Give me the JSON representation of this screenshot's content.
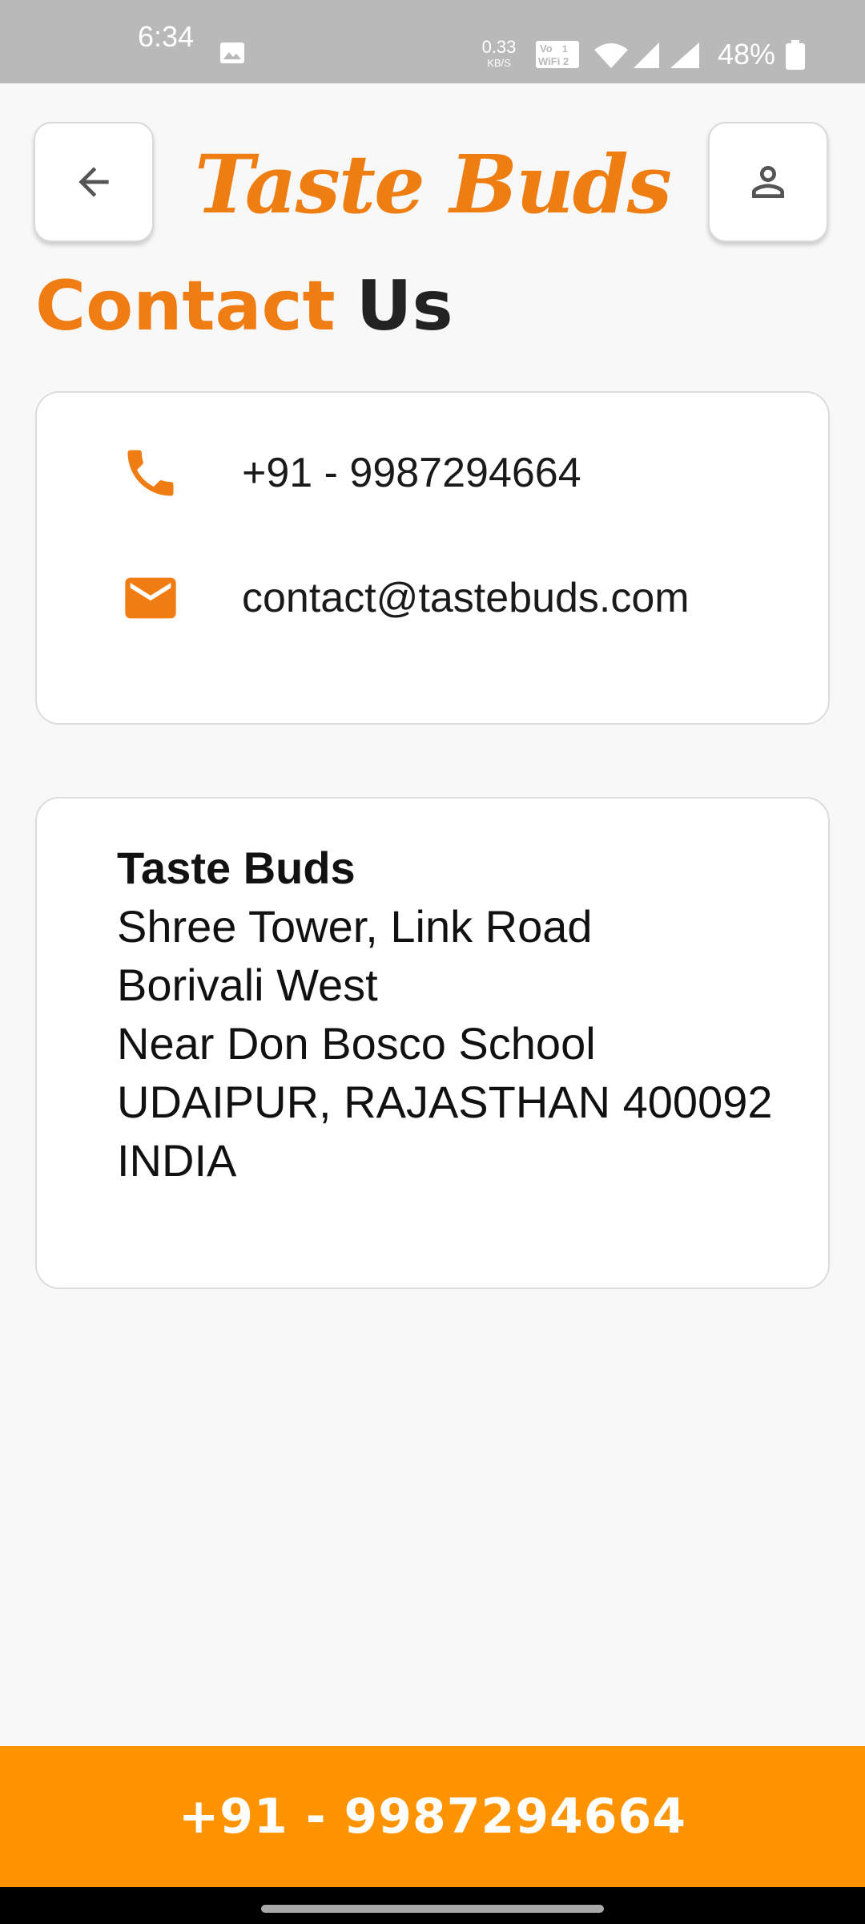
{
  "status_bar": {
    "time": "6:34",
    "net_speed_value": "0.33",
    "net_speed_unit": "KB/S",
    "volte_label": "Vo WiFi 2",
    "battery": "48%",
    "icons": [
      "image-icon",
      "volte-wifi-icon",
      "wifi-icon",
      "signal-icon",
      "signal-icon",
      "battery-icon"
    ]
  },
  "header": {
    "brand": "Taste Buds",
    "back_icon": "arrow-left-icon",
    "profile_icon": "person-icon"
  },
  "page_title": {
    "part1": "Contact",
    "part2": "Us"
  },
  "contact": {
    "phone": "+91 - 9987294664",
    "email": "contact@tastebuds.com",
    "phone_icon": "phone-icon",
    "email_icon": "mail-icon"
  },
  "address": {
    "name": "Taste Buds",
    "lines": [
      "Shree Tower, Link Road",
      "Borivali West",
      "Near Don Bosco School",
      "UDAIPUR, RAJASTHAN 400092",
      "INDIA"
    ]
  },
  "call_bar": {
    "label": "+91 - 9987294664"
  },
  "colors": {
    "accent": "#f07d14",
    "call_bar": "#ff9300",
    "background": "#f8f8f8",
    "status_bar": "#b9b9b9"
  }
}
